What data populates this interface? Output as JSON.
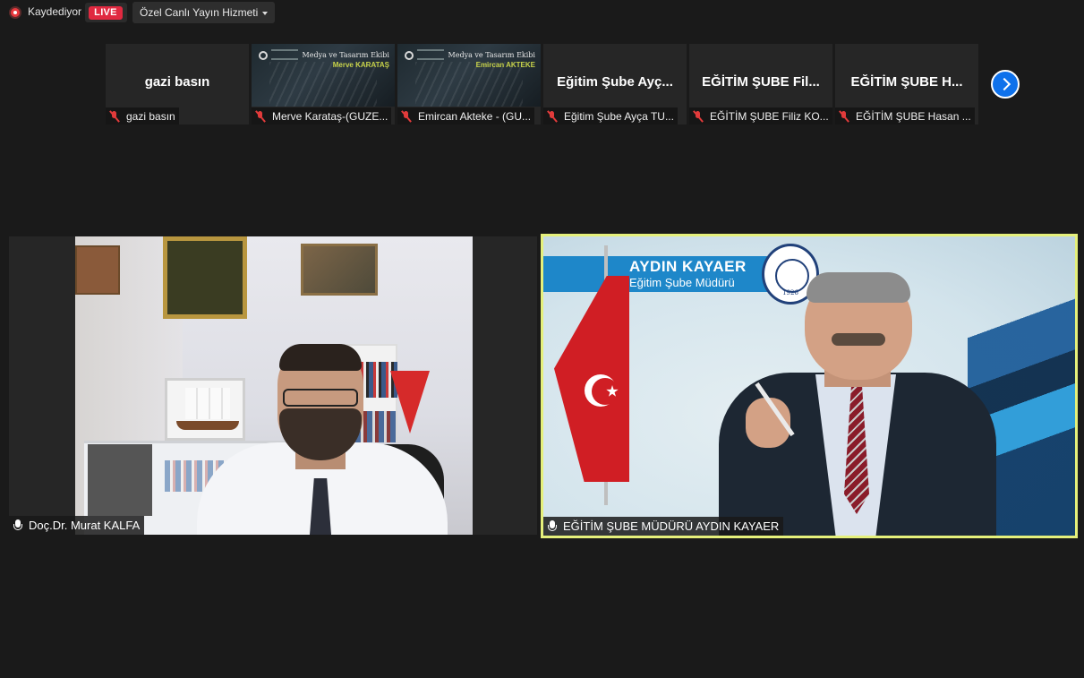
{
  "toolbar": {
    "recording_label": "Kaydediyor",
    "live_badge": "LIVE",
    "stream_service": "Özel Canlı Yayın Hizmeti"
  },
  "gallery": [
    {
      "center_name": "gazi basın",
      "label": "gazi basın",
      "has_video": false,
      "muted": true
    },
    {
      "center_name": "",
      "label": "Merve Karataş-(GUZE...",
      "has_video": true,
      "muted": true,
      "thumb_title": "Medya ve Tasarım Ekibi",
      "thumb_name": "Merve KARATAŞ"
    },
    {
      "center_name": "",
      "label": "Emircan Akteke - (GU...",
      "has_video": true,
      "muted": true,
      "thumb_title": "Medya ve Tasarım Ekibi",
      "thumb_name": "Emircan AKTEKE"
    },
    {
      "center_name": "Eğitim Şube Ayç...",
      "label": "Eğitim Şube Ayça TU...",
      "has_video": false,
      "muted": true
    },
    {
      "center_name": "EĞİTİM ŞUBE Fil...",
      "label": "EĞİTİM ŞUBE Filiz KO...",
      "has_video": false,
      "muted": true
    },
    {
      "center_name": "EĞİTİM ŞUBE H...",
      "label": "EĞİTİM ŞUBE Hasan ...",
      "has_video": false,
      "muted": true
    }
  ],
  "main_videos": {
    "left": {
      "name": "Doç.Dr. Murat KALFA"
    },
    "right": {
      "name": "EĞİTİM ŞUBE MÜDÜRÜ AYDIN KAYAER",
      "overlay_title": "AYDIN KAYAER",
      "overlay_subtitle": "Eğitim Şube Müdürü",
      "seal_year": "1926",
      "active_speaker_border": "#e5f07b"
    }
  },
  "colors": {
    "background": "#1a1a1a",
    "live_red": "#e02940",
    "next_button_blue": "#0e71eb",
    "muted_mic_red": "#e23b3b"
  }
}
